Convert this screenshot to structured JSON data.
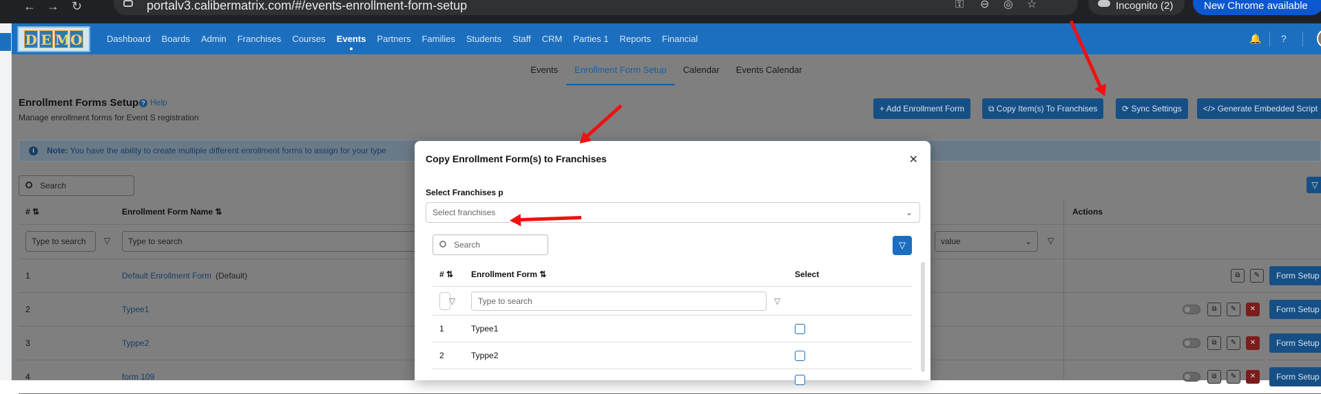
{
  "browser": {
    "url": "portalv3.calibermatrix.com/#/events-enrollment-form-setup",
    "incognito_label": "Incognito (2)",
    "new_chrome_label": "New Chrome available"
  },
  "topnav": {
    "logo_letters": [
      "D",
      "E",
      "M",
      "O"
    ],
    "items": [
      "Dashboard",
      "Boards",
      "Admin",
      "Franchises",
      "Courses",
      "Events",
      "Partners",
      "Families",
      "Students",
      "Staff",
      "CRM",
      "Parties 1",
      "Reports",
      "Financial"
    ],
    "active": "Events"
  },
  "subtabs": {
    "items": [
      "Events",
      "Enrollment Form Setup",
      "Calendar",
      "Events Calendar"
    ],
    "active": "Enrollment Form Setup"
  },
  "header": {
    "title": "Enrollment Forms Setup",
    "help_label": "Help",
    "subtitle": "Manage enrollment forms for Event S registration",
    "buttons": {
      "add": "Add Enrollment Form",
      "copy": "Copy Item(s) To Franchises",
      "sync": "Sync Settings",
      "embed": "Generate Embedded Script"
    }
  },
  "note": {
    "label": "Note:",
    "text": "You have the ability to create multiple different enrollment forms to assign for your type"
  },
  "table": {
    "search_placeholder": "Search",
    "headers": {
      "num": "#",
      "name": "Enrollment Form Name",
      "actions": "Actions"
    },
    "filter_placeholder": "Type to search",
    "select_value_placeholder": "value",
    "form_setup_label": "Form Setup",
    "rows": [
      {
        "num": "1",
        "name": "Default Enrollment Form",
        "tag": "(Default)"
      },
      {
        "num": "2",
        "name": "Typee1",
        "tag": ""
      },
      {
        "num": "3",
        "name": "Typpe2",
        "tag": ""
      },
      {
        "num": "4",
        "name": "form 109",
        "tag": ""
      }
    ]
  },
  "modal": {
    "title": "Copy Enrollment Form(s) to Franchises",
    "select_label": "Select Franchises p",
    "select_placeholder": "Select franchises",
    "search_placeholder": "Search",
    "headers": {
      "num": "#",
      "form": "Enrollment Form",
      "select": "Select"
    },
    "filter_placeholder": "Type to search",
    "rows": [
      {
        "num": "1",
        "name": "Typee1"
      },
      {
        "num": "2",
        "name": "Typpe2"
      }
    ]
  },
  "colors": {
    "nav_blue": "#1c6fbf",
    "arrow_red": "#ee1111",
    "modal_bg": "#ffffff"
  }
}
